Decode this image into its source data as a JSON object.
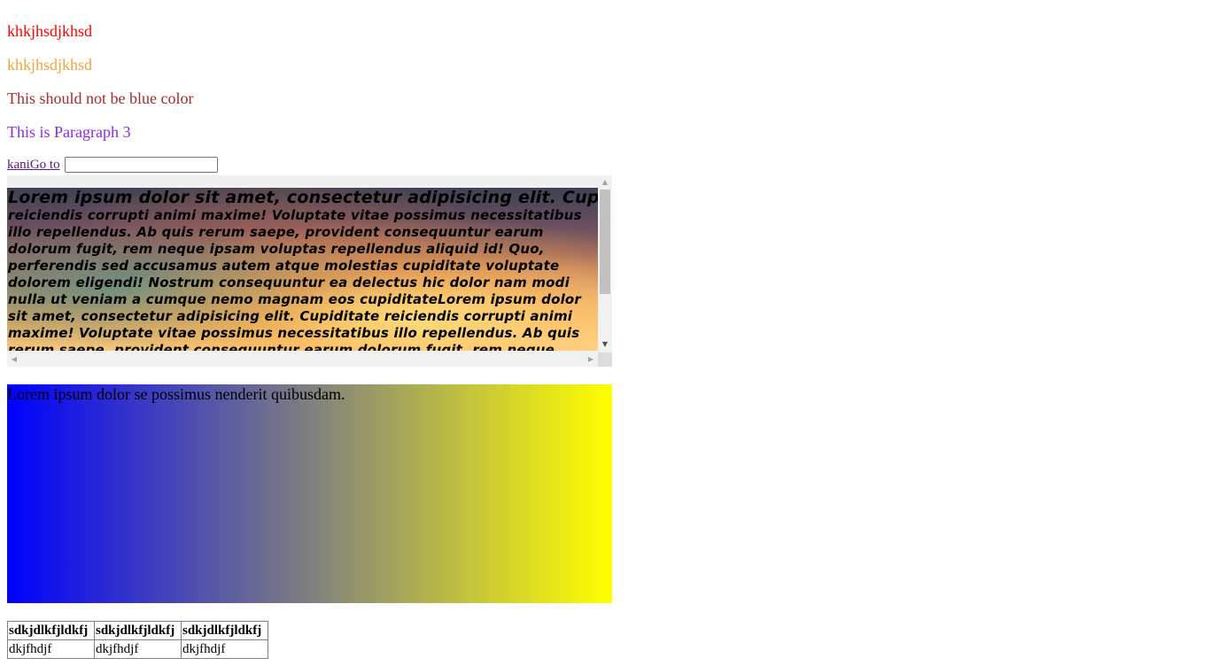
{
  "paragraphs": {
    "p1": "khkjhsdjkhsd",
    "p2": "khkjhsdjkhsd",
    "p3": "This should not be blue color",
    "p4": "This is Paragraph 3"
  },
  "goto": {
    "link_label": "kaniGo to",
    "input_value": ""
  },
  "scroll_box": {
    "heading": "Lorem ipsum dolor sit amet, consectetur adipisicing elit. Cupiditate",
    "body": "reiciendis corrupti animi maxime! Voluptate vitae possimus necessitatibus illo repellendus. Ab quis rerum saepe, provident consequuntur earum dolorum fugit, rem neque ipsam voluptas repellendus aliquid id! Quo, perferendis sed accusamus autem atque molestias cupiditate voluptate dolorem eligendi! Nostrum consequuntur ea delectus hic dolor nam modi nulla ut veniam a cumque nemo magnam eos cupiditateLorem ipsum dolor sit amet, consectetur adipisicing elit. Cupiditate reiciendis corrupti animi maxime! Voluptate vitae possimus necessitatibus illo repellendus. Ab quis rerum saepe, provident consequuntur earum dolorum fugit, rem neque ipsam voluptas repellendus"
  },
  "gradient_box": {
    "text": "Lorem ipsum dolor se possimus nenderit quibusdam."
  },
  "table": {
    "headers": [
      "sdkjdlkfjldkfj",
      "sdkjdlkfjldkfj",
      "sdkjdlkfjldkfj"
    ],
    "rows": [
      [
        "dkjfhdjf",
        "dkjfhdjf",
        "dkjfhdjf"
      ]
    ]
  },
  "colors": {
    "p1": "#ff0000",
    "p2": "#f2a33a",
    "p3": "#a52a2a",
    "p4": "#8a2be2",
    "gradient_start": "#0000ff",
    "gradient_end": "#ffff00"
  }
}
